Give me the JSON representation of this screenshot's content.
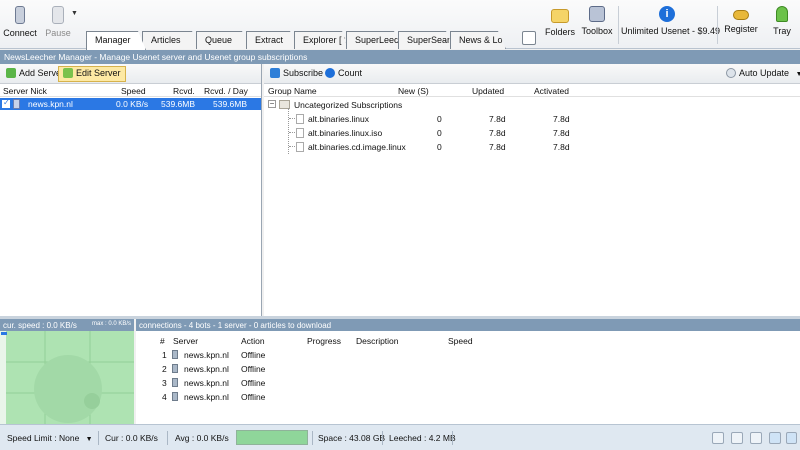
{
  "toolbar": {
    "connect": "Connect",
    "pause": "Pause",
    "folders": "Folders",
    "toolbox": "Toolbox",
    "unlimited": "Unlimited Usenet - $9.49",
    "register": "Register",
    "tray": "Tray"
  },
  "tabs": [
    "Manager",
    "Articles",
    "Queue",
    "Extract",
    "Explorer [ ?",
    "SuperLeech",
    "SuperSearc",
    "News & Lo"
  ],
  "infobar": "NewsLeecher Manager  -  Manage Usenet server and Usenet group subscriptions",
  "left": {
    "add_server": "Add Server",
    "edit_server": "Edit Server",
    "columns": {
      "nick": "Server Nick",
      "speed": "Speed",
      "rcvd": "Rcvd.",
      "rcvd_day": "Rcvd. / Day"
    },
    "server": {
      "name": "news.kpn.nl",
      "speed": "0.0 KB/s",
      "rcvd": "539.6MB",
      "rcvd_day": "539.6MB"
    }
  },
  "right": {
    "subscribe": "Subscribe",
    "count": "Count",
    "auto_update": "Auto Update",
    "columns": {
      "group": "Group Name",
      "new": "New (S)",
      "updated": "Updated",
      "activated": "Activated"
    },
    "folder": "Uncategorized Subscriptions",
    "groups": [
      {
        "name": "alt.binaries.linux",
        "new": "0",
        "updated": "7.8d",
        "activated": "7.8d"
      },
      {
        "name": "alt.binaries.linux.iso",
        "new": "0",
        "updated": "7.8d",
        "activated": "7.8d"
      },
      {
        "name": "alt.binaries.cd.image.linux",
        "new": "0",
        "updated": "7.8d",
        "activated": "7.8d"
      }
    ]
  },
  "graph": {
    "title": "cur. speed : 0.0 KB/s",
    "small": "max : 0.0 KB/s"
  },
  "connections": {
    "title": "connections  -  4 bots  -  1 server  -  0 articles to download",
    "columns": {
      "num": "#",
      "server": "Server",
      "action": "Action",
      "progress": "Progress",
      "description": "Description",
      "speed": "Speed"
    },
    "rows": [
      {
        "num": "1",
        "server": "news.kpn.nl",
        "action": "Offline"
      },
      {
        "num": "2",
        "server": "news.kpn.nl",
        "action": "Offline"
      },
      {
        "num": "3",
        "server": "news.kpn.nl",
        "action": "Offline"
      },
      {
        "num": "4",
        "server": "news.kpn.nl",
        "action": "Offline"
      }
    ]
  },
  "status": {
    "speed_limit": "Speed Limit : None",
    "cur": "Cur : 0.0 KB/s",
    "avg": "Avg : 0.0 KB/s",
    "space": "Space : 43.08 GB",
    "leeched": "Leeched : 4.2 MB",
    "progress_fraction": 1.0
  },
  "colors": {
    "accent": "#2b78e4",
    "header_bar": "#7f9ab5",
    "graph_bg": "#aee3b2",
    "statusbar": "#dfe8f1"
  }
}
